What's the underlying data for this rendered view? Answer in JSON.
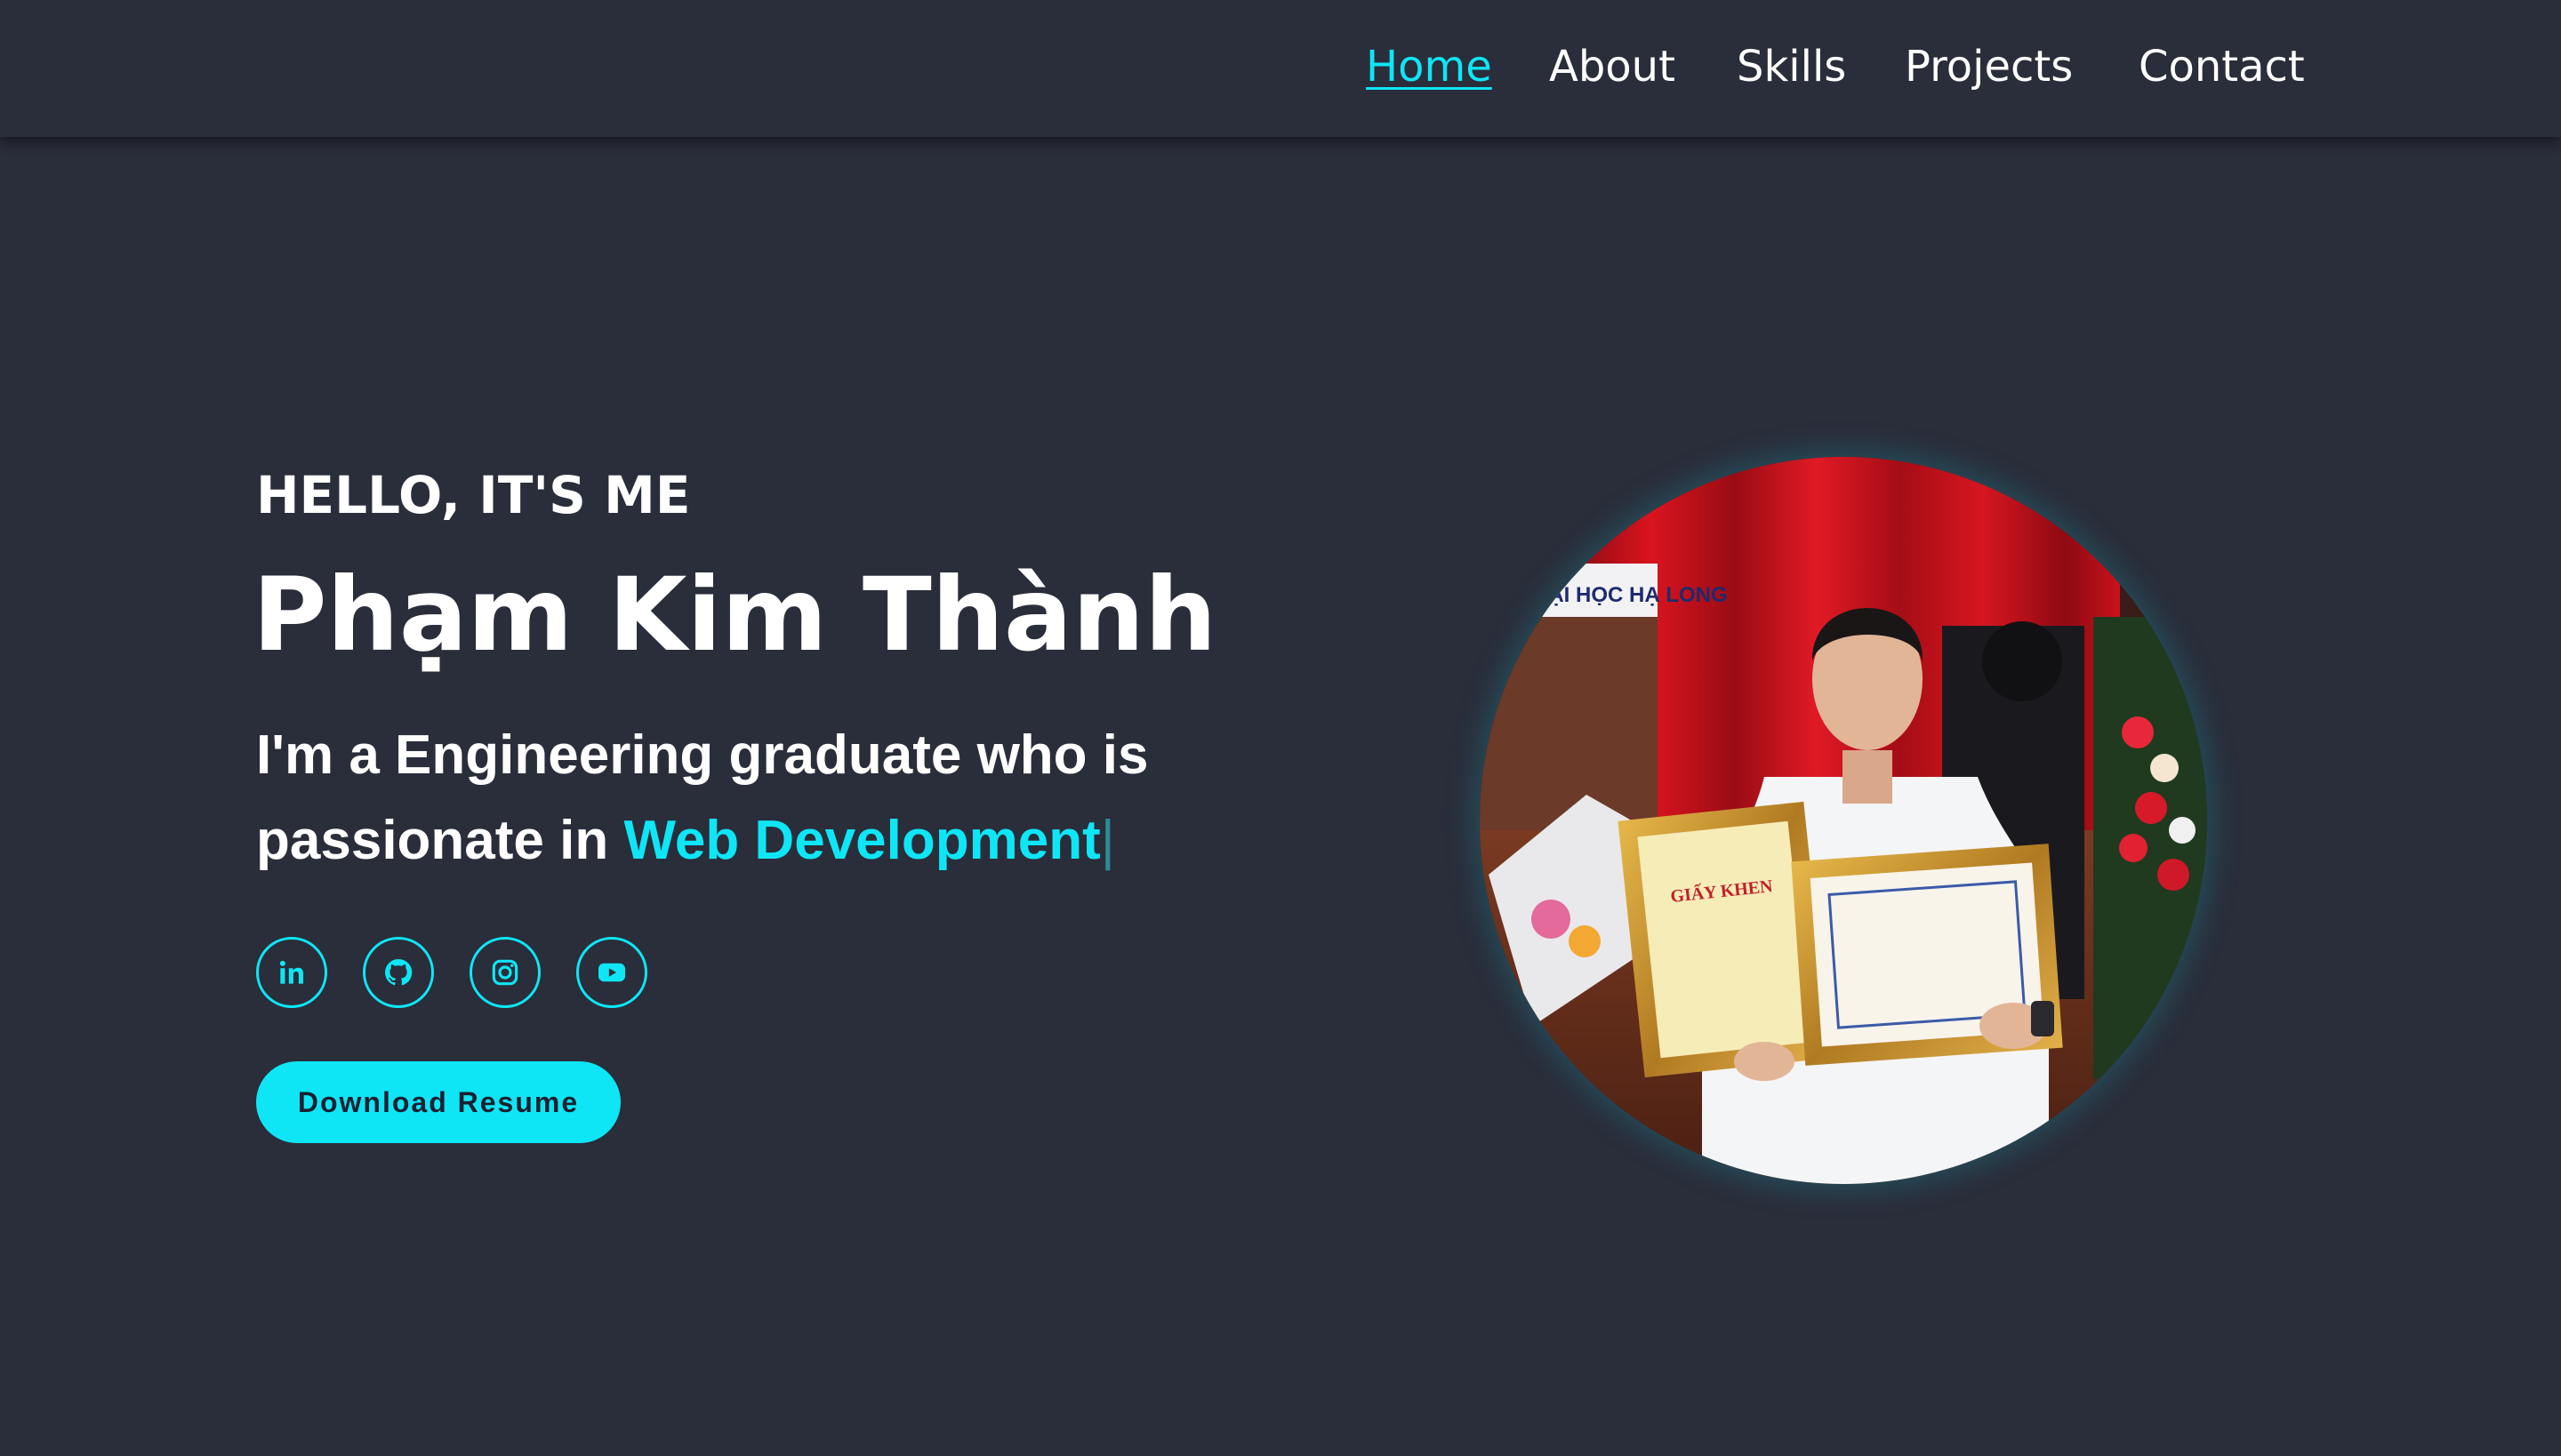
{
  "nav": {
    "items": [
      {
        "label": "Home",
        "active": true
      },
      {
        "label": "About"
      },
      {
        "label": "Skills"
      },
      {
        "label": "Projects"
      },
      {
        "label": "Contact"
      }
    ]
  },
  "hero": {
    "greeting": "HELLO, IT'S ME",
    "name": "Phạm Kim Thành",
    "tagline_prefix": "I'm a Engineering graduate who is passionate in ",
    "tagline_highlight": "Web Development",
    "cursor": "|",
    "resume_button": "Download Resume"
  },
  "socials": [
    {
      "icon": "linkedin-icon"
    },
    {
      "icon": "github-icon"
    },
    {
      "icon": "instagram-icon"
    },
    {
      "icon": "youtube-icon"
    }
  ],
  "photo": {
    "banner_text": "ĐẠI HỌC HẠ LONG",
    "certificate_title": "GIẤY KHEN"
  },
  "colors": {
    "background": "#2a2d3a",
    "accent": "#0ee6f6",
    "text": "#ffffff"
  }
}
